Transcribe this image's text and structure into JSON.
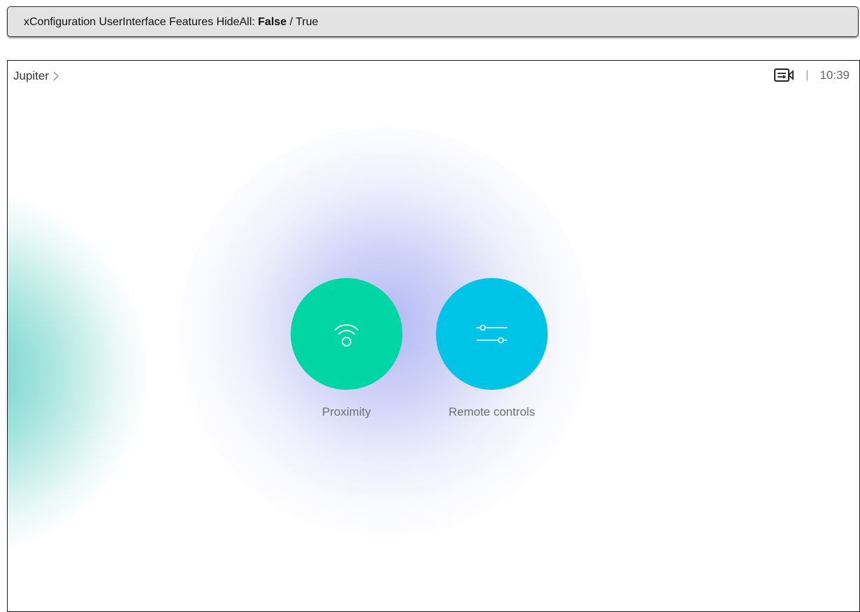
{
  "config_bar": {
    "prefix": "xConfiguration UserInterface Features HideAll: ",
    "value_selected": "False",
    "separator": " / ",
    "value_other": "True"
  },
  "header": {
    "room_name": "Jupiter",
    "time": "10:39",
    "separator": "|",
    "status_icon": "camera-self-view-icon"
  },
  "tiles": [
    {
      "label": "Proximity",
      "icon": "proximity-icon",
      "color": "#00d6a5"
    },
    {
      "label": "Remote controls",
      "icon": "sliders-icon",
      "color": "#00c3e8"
    }
  ],
  "colors": {
    "proximity": "#00d6a5",
    "remote_controls": "#00c3e8",
    "config_bar_bg": "#e3e3e3"
  }
}
